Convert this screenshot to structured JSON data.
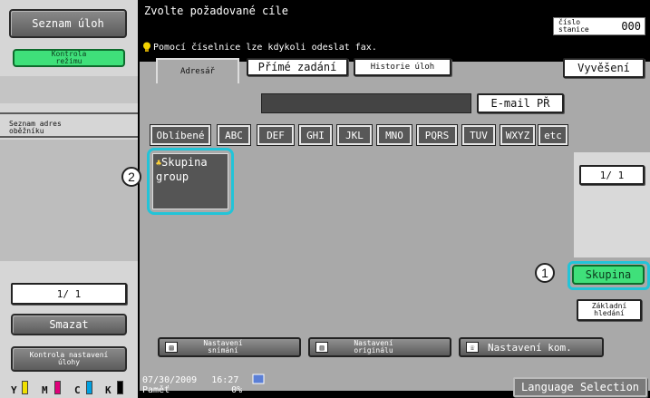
{
  "left": {
    "job_list_label": "Seznam úloh",
    "check_mode_label": "Kontrola režimu",
    "broadcast_list_label": "Seznam adres oběžníku",
    "page_counter": "1/  1",
    "delete_label": "Smazat",
    "check_job_settings_label": "Kontrola nastavení úlohy",
    "toner": [
      "Y",
      "M",
      "C",
      "K"
    ],
    "toner_colors": [
      "#f0e000",
      "#e0007a",
      "#00a0e0",
      "#000000"
    ]
  },
  "header": {
    "title": "Zvolte požadované cíle",
    "hint": "Pomocí číselnice lze kdykoli odeslat fax.",
    "station_label": "číslo stanice",
    "station_value": "000"
  },
  "tabs": [
    {
      "label": "Adresář",
      "active": true
    },
    {
      "label": "Přímé zadání",
      "active": false
    },
    {
      "label": "Historie úloh",
      "active": false
    }
  ],
  "post_button": "Vyvěšení",
  "email_button": "E-mail PŘ",
  "search_field": {
    "value": ""
  },
  "index_tabs": [
    "Oblíbené",
    "ABC",
    "DEF",
    "GHI",
    "JKL",
    "MNO",
    "PQRS",
    "TUV",
    "WXYZ",
    "etc"
  ],
  "entries": [
    {
      "label_line1": "Skupina",
      "label_line2": "group"
    }
  ],
  "list_page": "1/  1",
  "group_button": "Skupina",
  "basic_search_button": "Základní hledání",
  "callouts": [
    "1",
    "2"
  ],
  "bottom_buttons": [
    {
      "label": "Nastavení snímání",
      "icon": "scan-icon"
    },
    {
      "label": "Nastavení originálu",
      "icon": "original-icon"
    },
    {
      "label": "Nastavení kom.",
      "icon": "communication-icon"
    }
  ],
  "status": {
    "date": "07/30/2009",
    "time": "16:27",
    "memory_label": "Paměť",
    "memory_value": "0%"
  },
  "language_button": "Language Selection",
  "colors": {
    "accent_green": "#3fe07a",
    "selection_cyan": "#22c4d8"
  }
}
